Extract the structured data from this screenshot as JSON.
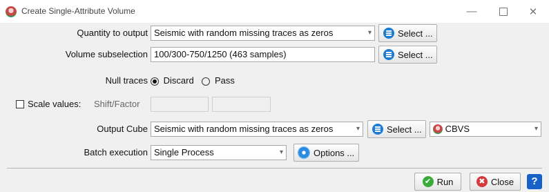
{
  "window": {
    "title": "Create Single-Attribute Volume",
    "min_icon": "—",
    "close_icon": "✕"
  },
  "quantity": {
    "label": "Quantity to output",
    "value": "Seismic with random missing traces as zeros",
    "select_label": "Select ..."
  },
  "volume": {
    "label": "Volume subselection",
    "value": "100/300-750/1250 (463 samples)",
    "select_label": "Select ..."
  },
  "null_traces": {
    "label": "Null traces",
    "option_discard": "Discard",
    "option_pass": "Pass",
    "selected": "Discard"
  },
  "scale": {
    "label": "Scale values:",
    "sublabel": "Shift/Factor",
    "checked": false
  },
  "output": {
    "label": "Output Cube",
    "value": "Seismic with random missing traces as zeros",
    "select_label": "Select ...",
    "survey_value": "CBVS"
  },
  "batch": {
    "label": "Batch execution",
    "value": "Single Process",
    "options_label": "Options ..."
  },
  "footer": {
    "run_label": "Run",
    "close_label": "Close",
    "help_label": "?"
  },
  "icons": {
    "arrow": "▾",
    "check": "✔",
    "x": "✖"
  }
}
